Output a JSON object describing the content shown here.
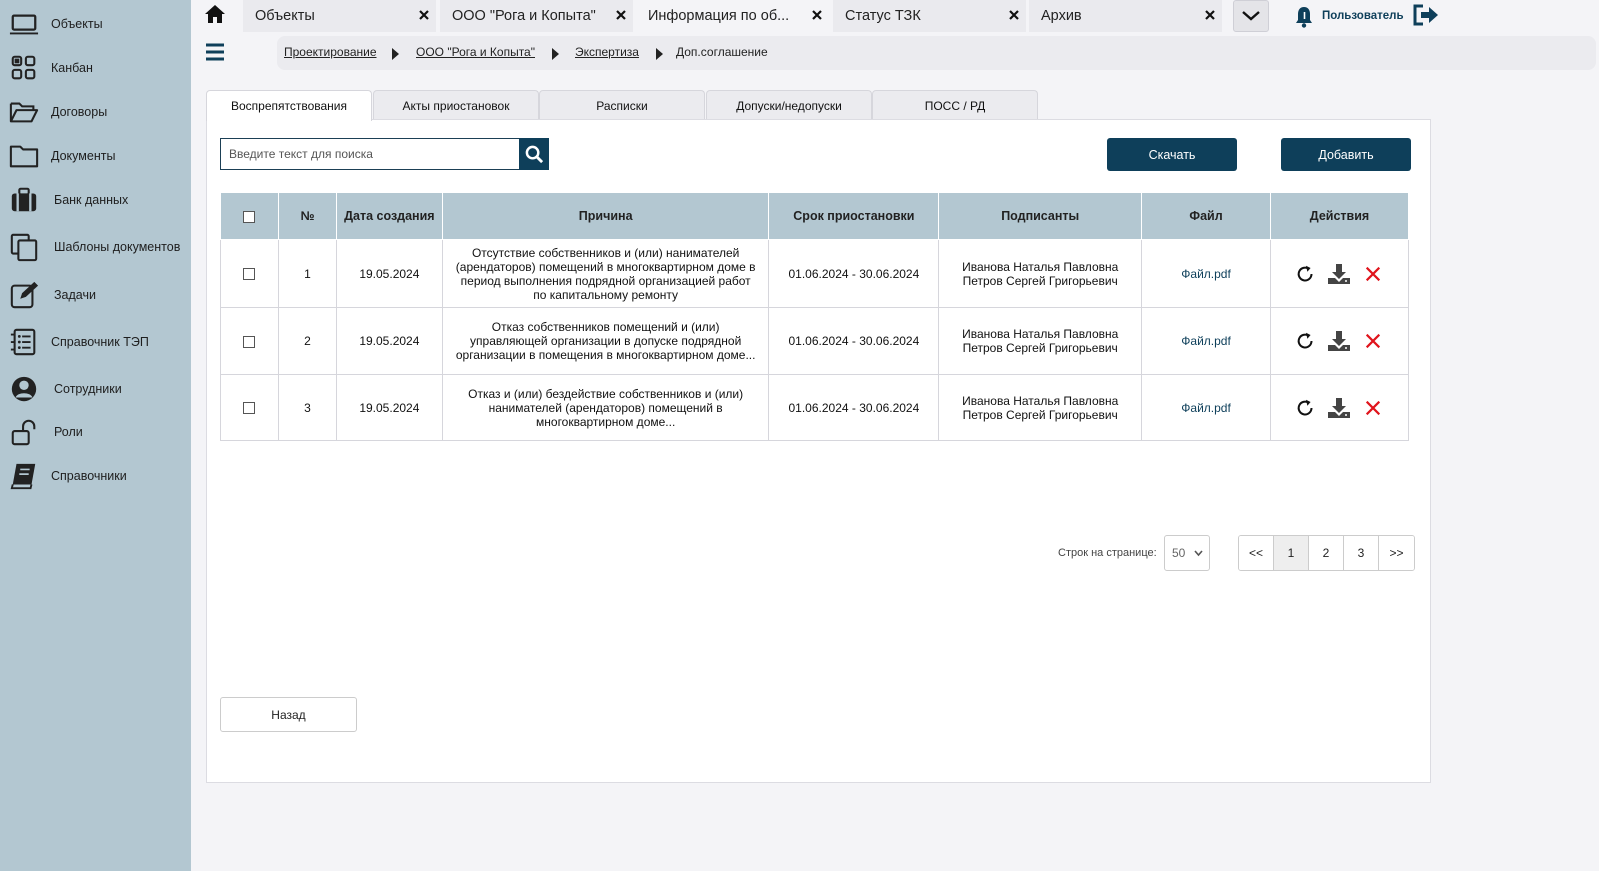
{
  "sidebar": {
    "items": [
      {
        "label": "Объекты",
        "icon": "laptop-icon"
      },
      {
        "label": "Канбан",
        "icon": "kanban-icon"
      },
      {
        "label": "Договоры",
        "icon": "folder-open-icon"
      },
      {
        "label": "Документы",
        "icon": "folder-icon"
      },
      {
        "label": "Банк данных",
        "icon": "briefcase-icon"
      },
      {
        "label": "Шаблоны документов",
        "icon": "copy-icon"
      },
      {
        "label": "Задачи",
        "icon": "edit-icon"
      },
      {
        "label": "Справочник ТЭП",
        "icon": "list-icon"
      },
      {
        "label": "Сотрудники",
        "icon": "user-circle-icon"
      },
      {
        "label": "Роли",
        "icon": "unlock-icon"
      },
      {
        "label": "Справочники",
        "icon": "book-icon"
      }
    ]
  },
  "tabs": [
    {
      "label": "Объекты"
    },
    {
      "label": "ООО \"Рога и Копыта\""
    },
    {
      "label": "Информация по об..."
    },
    {
      "label": "Статус ТЗК"
    },
    {
      "label": "Архив"
    }
  ],
  "header": {
    "user_label": "Пользователь"
  },
  "breadcrumb": [
    {
      "label": "Проектирование"
    },
    {
      "label": "ООО \"Рога и Копыта\""
    },
    {
      "label": "Экспертиза"
    },
    {
      "label": "Доп.соглашение"
    }
  ],
  "subtabs": [
    {
      "label": "Воспрепятствования"
    },
    {
      "label": "Акты приостановок"
    },
    {
      "label": "Расписки"
    },
    {
      "label": "Допуски/недопуски"
    },
    {
      "label": "ПОСС / РД"
    }
  ],
  "toolbar": {
    "search_placeholder": "Введите текст для поиска",
    "download_label": "Скачать",
    "add_label": "Добавить"
  },
  "table": {
    "headers": [
      "№",
      "Дата создания",
      "Причина",
      "Срок приостановки",
      "Подписанты",
      "Файл",
      "Действия"
    ],
    "rows": [
      {
        "num": "1",
        "date": "19.05.2024",
        "reason": "Отсутствие собственников и (или) нанимателей (арендаторов) помещений в многоквартирном доме в период выполнения подрядной организацией работ по капитальному ремонту",
        "period": "01.06.2024 - 30.06.2024",
        "signer1": "Иванова Наталья Павловна",
        "signer2": "Петров Сергей Григорьевич",
        "file": "Файл.pdf"
      },
      {
        "num": "2",
        "date": "19.05.2024",
        "reason": "Отказ собственников помещений и (или) управляющей организации в допуске подрядной организации в помещения в многоквартирном доме...",
        "period": "01.06.2024 - 30.06.2024",
        "signer1": "Иванова Наталья Павловна",
        "signer2": "Петров Сергей Григорьевич",
        "file": "Файл.pdf"
      },
      {
        "num": "3",
        "date": "19.05.2024",
        "reason": "Отказ и (или) бездействие собственников и (или) нанимателей (арендаторов) помещений в многоквартирном доме...",
        "period": "01.06.2024 - 30.06.2024",
        "signer1": "Иванова Наталья Павловна",
        "signer2": "Петров Сергей Григорьевич",
        "file": "Файл.pdf"
      }
    ]
  },
  "pagination": {
    "rows_label": "Строк на странице:",
    "rows_value": "50",
    "first": "<<",
    "pages": [
      "1",
      "2",
      "3"
    ],
    "last": ">>"
  },
  "footer": {
    "back_label": "Назад"
  },
  "colors": {
    "sidebar_bg": "#b3c7d1",
    "primary": "#0e3f5a",
    "delete": "#e0141c"
  }
}
